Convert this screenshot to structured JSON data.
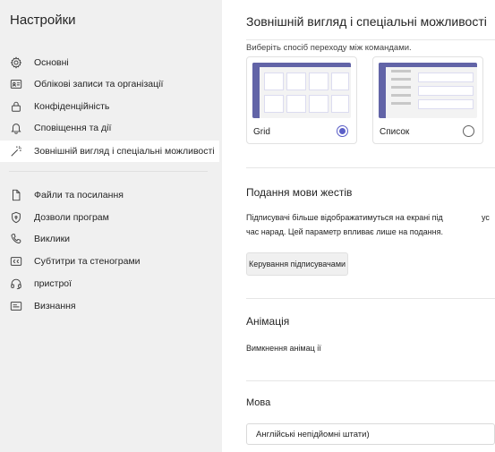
{
  "sidebar": {
    "title": "Настройки",
    "items": [
      {
        "label": "Основні",
        "icon": "gear-icon"
      },
      {
        "label": "Облікові записи та організації",
        "icon": "id-card-icon"
      },
      {
        "label": "Конфіденційність",
        "icon": "lock-icon"
      },
      {
        "label": "Сповіщення та дії",
        "icon": "bell-icon"
      },
      {
        "label": "Зовнішній вигляд і спеціальні можливості",
        "icon": "magic-wand-icon"
      },
      {
        "label": "Файли та посилання",
        "icon": "file-icon"
      },
      {
        "label": "Дозволи програм",
        "icon": "shield-icon"
      },
      {
        "label": "Виклики",
        "icon": "phone-icon"
      },
      {
        "label": "Субтитри та стенограми",
        "icon": "closed-captions-icon"
      },
      {
        "label": "пристрої",
        "icon": "headset-icon"
      },
      {
        "label": "Визнання",
        "icon": "badge-icon"
      }
    ]
  },
  "main": {
    "title": "Зовнішній вигляд і спеціальні можливості",
    "navigation_hint": "Виберіть спосіб переходу між командами.",
    "layout_options": [
      {
        "label": "Grid",
        "selected": true
      },
      {
        "label": "Список",
        "selected": false
      }
    ],
    "sign_language": {
      "title": "Подання мови жестів",
      "line1": "Підписувачі більше відображатимуться на екрані під",
      "line1_cut": "ус",
      "line2": "час нарад. Цей параметр впливає лише на подання.",
      "button": "Керування підписувачами"
    },
    "animation": {
      "title": "Анімація",
      "toggle_label": "Вимкнення  анімац ії"
    },
    "language": {
      "title": "Мова",
      "selected": "Англійські непідйомні штати)"
    }
  },
  "colors": {
    "accent": "#5b5fc7",
    "thumb_bar": "#6264a7",
    "sidebar_bg": "#f0f0f0"
  }
}
